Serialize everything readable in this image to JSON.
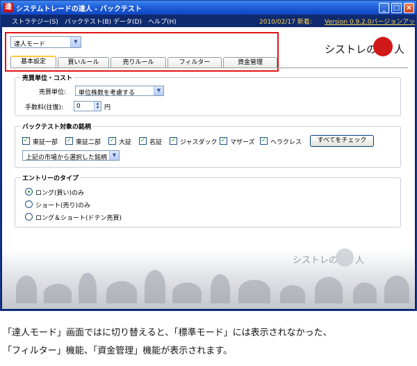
{
  "window": {
    "title": "システムトレードの達人 - バックテスト",
    "title_icon": "達",
    "minimize_icon": "_",
    "maximize_icon": "□",
    "close_icon": "×"
  },
  "menu": {
    "items": [
      "ストラテジー(S)",
      "バックテスト(B)",
      "データ(D)",
      "ヘルプ(H)"
    ],
    "news_date": "2010/02/17 新着:",
    "version_link": "Version 0.9.2.0バージョンアッ"
  },
  "mode_select": {
    "value": "達人モード"
  },
  "logo": {
    "text_left": "シストレの",
    "seal_char": "達",
    "text_right": "人"
  },
  "tabs": [
    {
      "label": "基本設定",
      "active": true
    },
    {
      "label": "買いルール",
      "active": false
    },
    {
      "label": "売りルール",
      "active": false
    },
    {
      "label": "フィルター",
      "active": false
    },
    {
      "label": "資金管理",
      "active": false
    }
  ],
  "unit_cost": {
    "title": "売買単位・コスト",
    "unit_label": "売買単位:",
    "unit_value": "単位株数を考慮する",
    "fee_label": "手数料(往復):",
    "fee_value": "0",
    "fee_unit": "円"
  },
  "markets": {
    "title": "バックテスト対象の銘柄",
    "checkboxes": [
      "東証一部",
      "東証二部",
      "大証",
      "名証",
      "ジャスダック",
      "マザーズ",
      "ヘラクレス"
    ],
    "check_all_button": "すべてをチェック",
    "selection_value": "上記の市場から選択した銘柄"
  },
  "entry": {
    "title": "エントリーのタイプ",
    "options": [
      "ロング(買い)のみ",
      "ショート(売り)のみ",
      "ロング＆ショート(ドテン売買)"
    ],
    "selected_index": 0
  },
  "watermark": {
    "text_left": "シストレの",
    "text_right": "人"
  },
  "caption": {
    "line1": "「達人モード」画面ではに切り替えると、「標準モード」には表示されなかった、",
    "line2": "「フィルター」機能、「資金管理」機能が表示されます。"
  }
}
